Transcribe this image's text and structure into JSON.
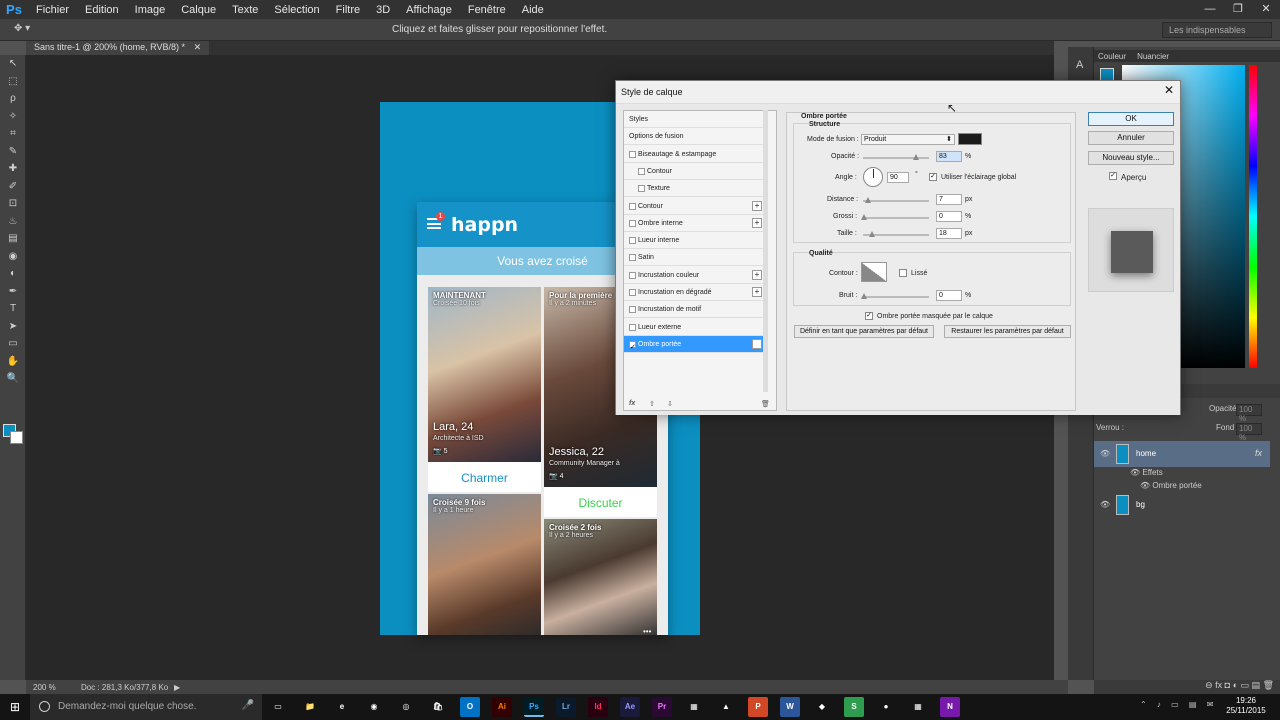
{
  "app": {
    "logo": "Ps"
  },
  "menu": [
    "Fichier",
    "Edition",
    "Image",
    "Calque",
    "Texte",
    "Sélection",
    "Filtre",
    "3D",
    "Affichage",
    "Fenêtre",
    "Aide"
  ],
  "window_controls": [
    "—",
    "❐",
    "✕"
  ],
  "options_bar": {
    "hint": "Cliquez et faites glisser pour repositionner l'effet.",
    "workspace": "Les indispensables"
  },
  "document": {
    "tab_title": "Sans titre-1 @ 200% (home, RVB/8) *",
    "tab_close": "✕"
  },
  "tools": [
    "↖",
    "⬚",
    "ρ",
    "✧",
    "⌗",
    "✎",
    "✚",
    "✐",
    "⊡",
    "♨",
    "▤",
    "◉",
    "◐",
    "✒",
    "T",
    "➤",
    "▭",
    "✋",
    "🔍"
  ],
  "app_preview": {
    "logo_text": "happn",
    "notification_count": "1",
    "header": "Vous avez croisé",
    "cards": [
      {
        "line1": "MAINTENANT",
        "line2": "Croisée 10 fois",
        "name": "Lara, 24",
        "job": "Architecte à ISD",
        "count": "📷 5",
        "action": "Charmer",
        "action_color": "#1593c8"
      },
      {
        "line1": "Pour la première",
        "line2": "Il y a 2 minutes",
        "name": "Jessica, 22",
        "job": "Community Manager à",
        "count": "📷 4",
        "action": "Discuter",
        "action_color": "#3ccf4e"
      },
      {
        "line1": "Croisée 9 fois",
        "line2": "Il y a 1 heure",
        "name": "",
        "job": "",
        "count": "",
        "action": "",
        "action_color": ""
      },
      {
        "line1": "Croisée 2 fois",
        "line2": "Il y a 2 heures",
        "name": "",
        "job": "",
        "count": "",
        "action": "",
        "action_color": ""
      }
    ],
    "more": "•••"
  },
  "right_panel": {
    "tabs": [
      "Couleur",
      "Nuancier"
    ],
    "opacity_label": "Opacité :",
    "opacity_value": "100 %",
    "lock_label": "Verrou :",
    "fill_label": "Fond :",
    "fill_value": "100 %",
    "layers": [
      {
        "name": "home",
        "fx": "fx"
      },
      {
        "name": "bg"
      }
    ],
    "effects_label": "Effets",
    "effect_name": "Ombre portée",
    "footer": "⊖  fx  ◘  ◐  ▭  ▤  🗑"
  },
  "status": {
    "zoom": "200 %",
    "doc": "Doc : 281,3 Ko/377,8 Ko",
    "arrow": "▶"
  },
  "taskbar": {
    "search_placeholder": "Demandez-moi quelque chose.",
    "mic": "🎤",
    "apps": [
      "▭",
      "📁",
      "e",
      "◉",
      "◎",
      "🛍",
      "O",
      "Ai",
      "Ps",
      "Lr",
      "Id",
      "Ae",
      "Pr",
      "▦",
      "▲",
      "P",
      "W",
      "◆",
      "S",
      "●",
      "▦",
      "N"
    ],
    "tray": "⌃ ♪ ▭ ▤ ✉",
    "time": "19:26",
    "date": "25/11/2015"
  },
  "dialog": {
    "title": "Style de calque",
    "close": "✕",
    "styles": [
      {
        "label": "Styles",
        "checkbox": false,
        "plus": false,
        "indent": false,
        "selected": false
      },
      {
        "label": "Options de fusion",
        "checkbox": false,
        "plus": false,
        "indent": false,
        "selected": false
      },
      {
        "label": "Biseautage & estampage",
        "checkbox": true,
        "plus": false,
        "indent": false,
        "selected": false
      },
      {
        "label": "Contour",
        "checkbox": true,
        "plus": false,
        "indent": true,
        "selected": false
      },
      {
        "label": "Texture",
        "checkbox": true,
        "plus": false,
        "indent": true,
        "selected": false
      },
      {
        "label": "Contour",
        "checkbox": true,
        "plus": true,
        "indent": false,
        "selected": false
      },
      {
        "label": "Ombre interne",
        "checkbox": true,
        "plus": true,
        "indent": false,
        "selected": false
      },
      {
        "label": "Lueur interne",
        "checkbox": true,
        "plus": false,
        "indent": false,
        "selected": false
      },
      {
        "label": "Satin",
        "checkbox": true,
        "plus": false,
        "indent": false,
        "selected": false
      },
      {
        "label": "Incrustation couleur",
        "checkbox": true,
        "plus": true,
        "indent": false,
        "selected": false
      },
      {
        "label": "Incrustation en dégradé",
        "checkbox": true,
        "plus": true,
        "indent": false,
        "selected": false
      },
      {
        "label": "Incrustation de motif",
        "checkbox": true,
        "plus": false,
        "indent": false,
        "selected": false
      },
      {
        "label": "Lueur externe",
        "checkbox": true,
        "plus": false,
        "indent": false,
        "selected": false
      },
      {
        "label": "Ombre portée",
        "checkbox": true,
        "plus": true,
        "indent": false,
        "selected": true
      }
    ],
    "list_footer": {
      "fx": "fx",
      "up": "⇧",
      "down": "⇩",
      "trash": "🗑"
    },
    "section_title": "Ombre portée",
    "structure_title": "Structure",
    "blend_label": "Mode de fusion :",
    "blend_value": "Produit",
    "shadow_color": "#1a1a1a",
    "opacity_label": "Opacité :",
    "opacity_value": "83",
    "pct": "%",
    "angle_label": "Angle :",
    "angle_value": "90",
    "deg": "°",
    "global_light_label": "Utiliser l'éclairage global",
    "distance_label": "Distance :",
    "distance_value": "7",
    "px": "px",
    "spread_label": "Grossi :",
    "spread_value": "0",
    "size_label": "Taille :",
    "size_value": "18",
    "quality_title": "Qualité",
    "contour_label": "Contour :",
    "smooth_label": "Lissé",
    "noise_label": "Bruit :",
    "noise_value": "0",
    "knockout_label": "Ombre portée masquée par le calque",
    "default_btn": "Définir en tant que paramètres par défaut",
    "reset_btn": "Restaurer les paramètres par défaut",
    "ok": "OK",
    "cancel": "Annuler",
    "new_style": "Nouveau style...",
    "preview_label": "Aperçu",
    "check": "✓"
  }
}
